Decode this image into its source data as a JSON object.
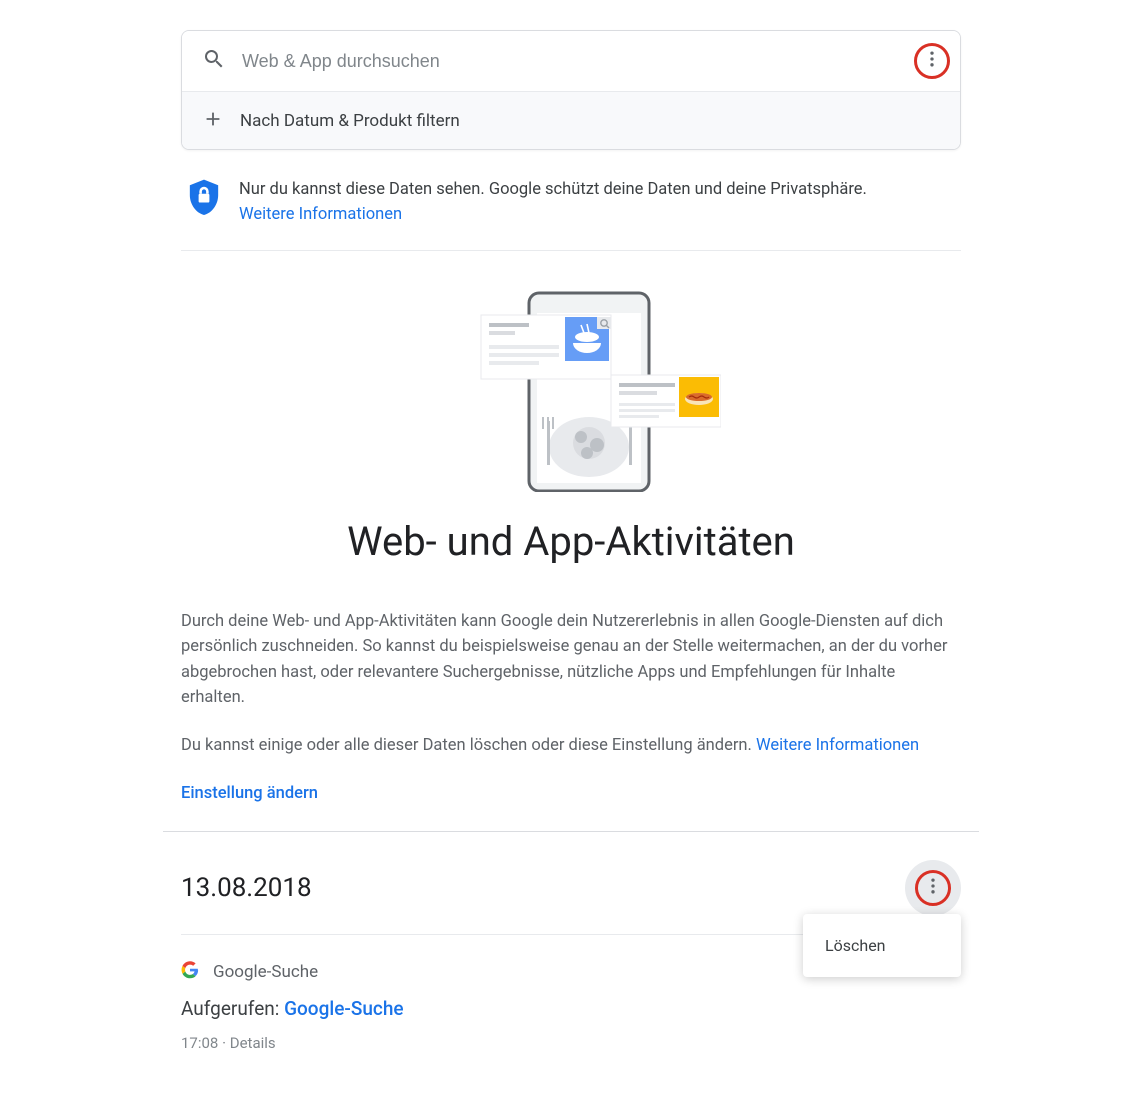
{
  "search": {
    "placeholder": "Web & App durchsuchen"
  },
  "filter": {
    "label": "Nach Datum & Produkt filtern"
  },
  "privacy": {
    "text": "Nur du kannst diese Daten sehen. Google schützt deine Daten und deine Privatsphäre.",
    "link_label": "Weitere Informationen"
  },
  "hero": {
    "title": "Web- und App-Aktivitäten"
  },
  "description": {
    "para1": "Durch deine Web- und App-Aktivitäten kann Google dein Nutzererlebnis in allen Google-Diensten auf dich persönlich zuschneiden. So kannst du beispielsweise genau an der Stelle weitermachen, an der du vorher abgebrochen hast, oder relevantere Suchergebnisse, nützliche Apps und Empfehlungen für Inhalte erhalten.",
    "para2_prefix": "Du kannst einige oder alle dieser Daten löschen oder diese Einstellung ändern. ",
    "para2_link": "Weitere Informationen",
    "settings_link": "Einstellung ändern"
  },
  "activity": {
    "date": "13.08.2018",
    "menu": {
      "delete_label": "Löschen"
    },
    "item": {
      "service": "Google-Suche",
      "action_prefix": "Aufgerufen: ",
      "action_link": "Google-Suche",
      "time": "17:08",
      "details_label": "Details"
    }
  }
}
